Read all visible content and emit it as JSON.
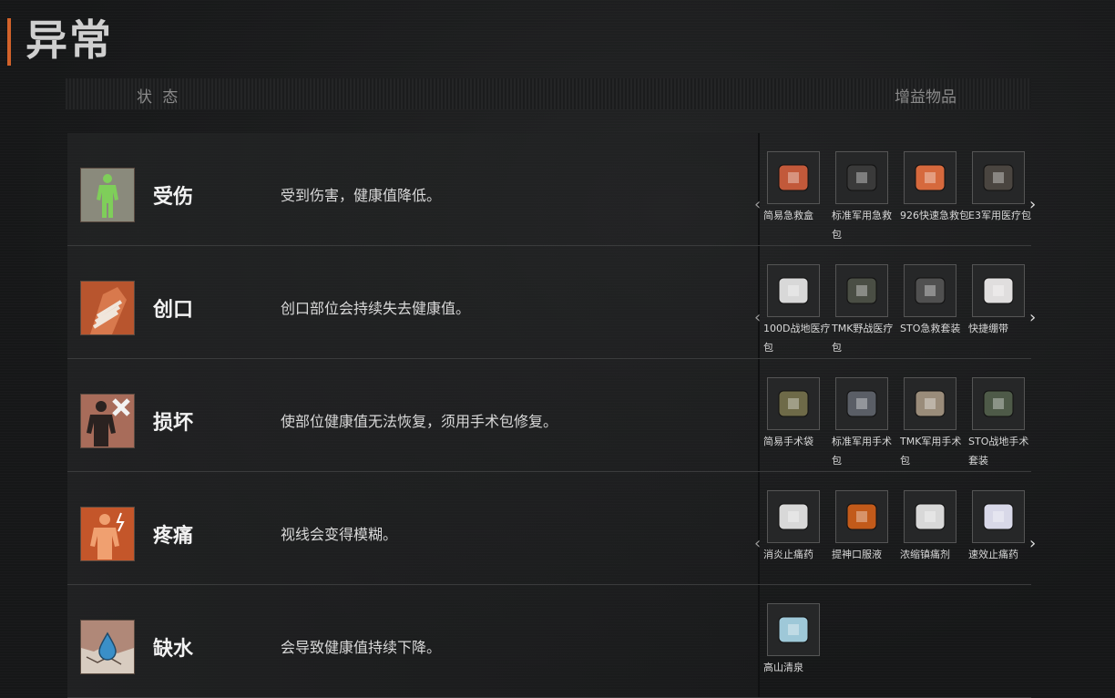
{
  "page": {
    "title": "异常"
  },
  "columns": {
    "status": "状 态",
    "buff": "增益物品"
  },
  "rows": [
    {
      "name": "受伤",
      "desc": "受到伤害，健康值降低。",
      "items": [
        "简易急救盒",
        "标准军用急救包",
        "926快速急救包",
        "E3军用医疗包"
      ],
      "arrows": true
    },
    {
      "name": "创口",
      "desc": "创口部位会持续失去健康值。",
      "items": [
        "100D战地医疗包",
        "TMK野战医疗包",
        "STO急救套装",
        "快捷绷带"
      ],
      "arrows": true
    },
    {
      "name": "损坏",
      "desc": "使部位健康值无法恢复，须用手术包修复。",
      "items": [
        "简易手术袋",
        "标准军用手术包",
        "TMK军用手术包",
        "STO战地手术套装"
      ],
      "arrows": false
    },
    {
      "name": "疼痛",
      "desc": "视线会变得模糊。",
      "items": [
        "消炎止痛药",
        "提神口服液",
        "浓缩镇痛剂",
        "速效止痛药"
      ],
      "arrows": true
    },
    {
      "name": "缺水",
      "desc": "会导致健康值持续下降。",
      "items": [
        "高山清泉"
      ],
      "arrows": false
    }
  ],
  "icons": {
    "arrow_left": "‹",
    "arrow_right": "›",
    "status": [
      "injury-body-icon",
      "wound-bandage-icon",
      "damaged-body-icon",
      "pain-body-icon",
      "dehydration-drop-icon"
    ]
  },
  "colors": {
    "accent": "#d2622a"
  }
}
